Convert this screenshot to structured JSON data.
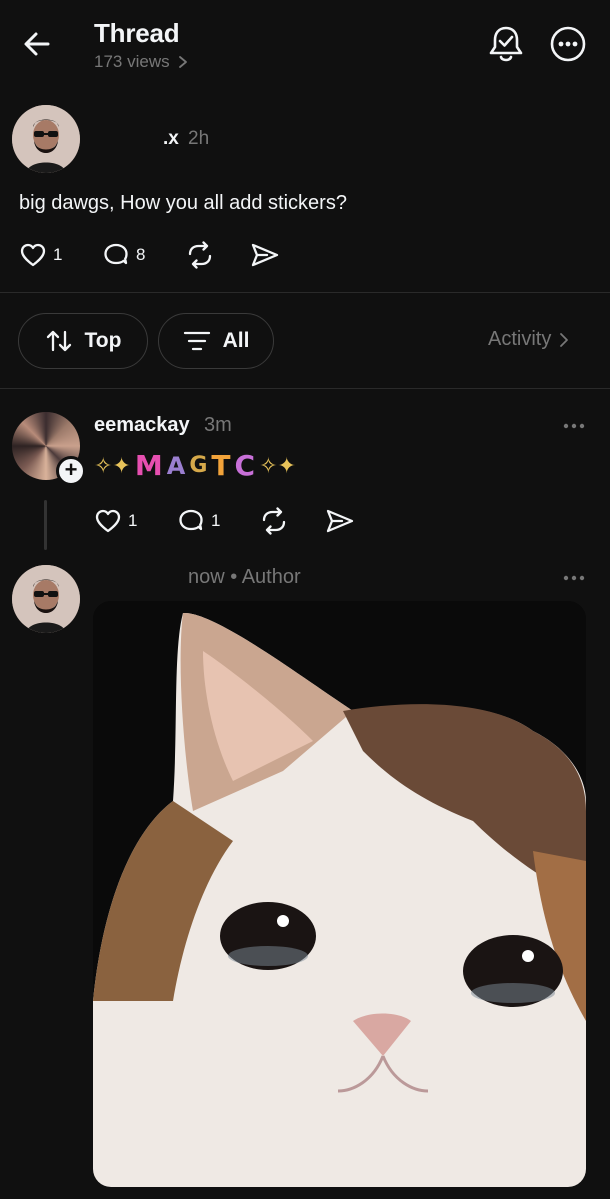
{
  "header": {
    "title": "Thread",
    "views": "173 views"
  },
  "original_post": {
    "username": ".x",
    "time": "2h",
    "text": "big dawgs, How you all add stickers?",
    "likes": "1",
    "comments": "8"
  },
  "filters": {
    "sort_label": "Top",
    "filter_label": "All",
    "activity_label": "Activity"
  },
  "replies": [
    {
      "username": "eemackay",
      "time": "3m",
      "stickers": [
        "M",
        "A",
        "G",
        "T",
        "C"
      ],
      "likes": "1",
      "comments": "1"
    },
    {
      "username": "",
      "meta": "now • Author",
      "image": "crying-cat-meme"
    }
  ],
  "colors": {
    "background": "#101010",
    "text": "#f3f5f7",
    "muted": "#777777",
    "divider": "#2a2a2a"
  }
}
